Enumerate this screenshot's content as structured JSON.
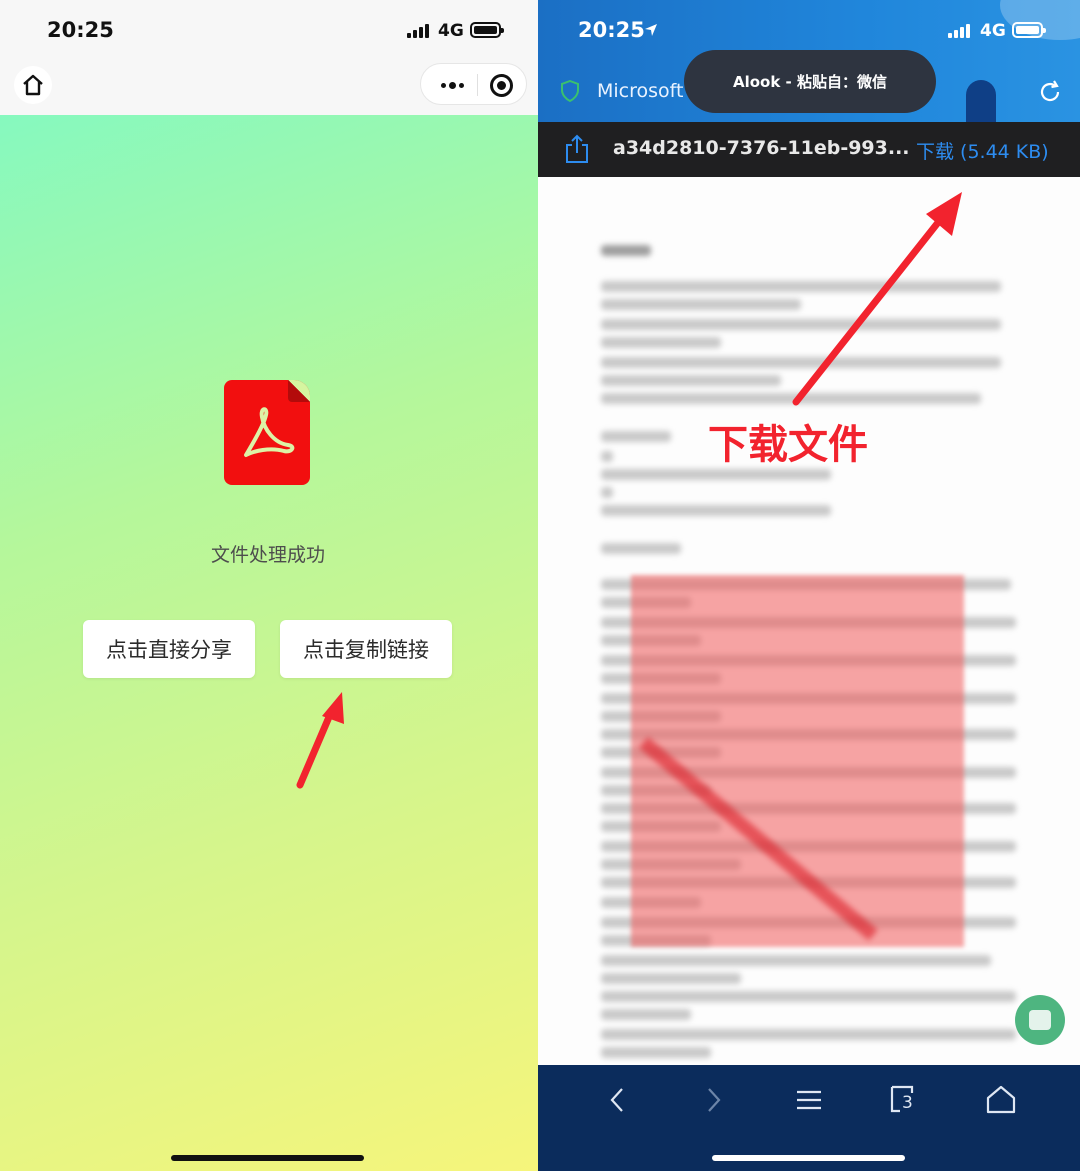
{
  "left_phone": {
    "status": {
      "time": "20:25",
      "network": "4G"
    },
    "status_message": "文件处理成功",
    "buttons": {
      "share": "点击直接分享",
      "copy_link": "点击复制链接"
    }
  },
  "right_phone": {
    "status": {
      "time": "20:25",
      "network": "4G"
    },
    "tab_title": "Microsoft",
    "toast": "Alook - 粘贴自：微信",
    "download_bar": {
      "file_name": "a34d2810-7376-11eb-993...",
      "download_label": "下载 (5.44 KB)"
    },
    "bottom_nav": {
      "tab_count": "3"
    }
  },
  "annotation": {
    "label": "下载文件",
    "color": "#f2232e"
  },
  "colors": {
    "pdf_red": "#f20f0f",
    "link_blue": "#2d8cf0",
    "browser_bar": "#0b2c5c"
  }
}
